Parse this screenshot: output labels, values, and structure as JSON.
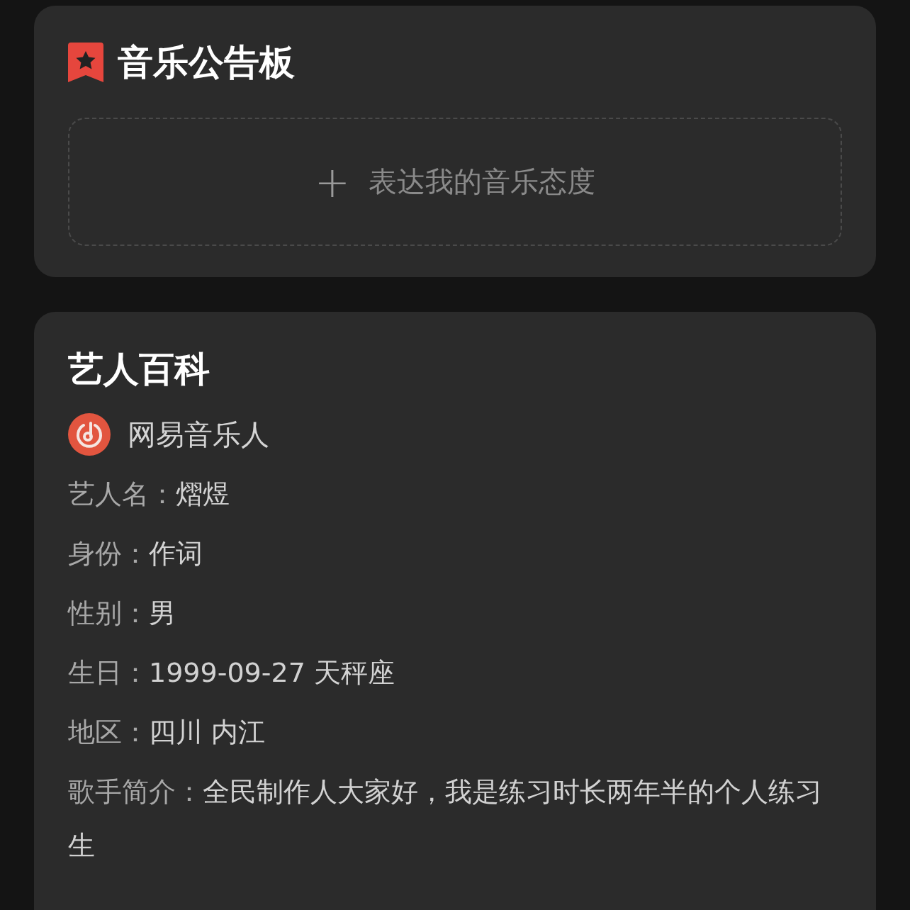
{
  "bulletin": {
    "title": "音乐公告板",
    "add_button": {
      "icon": "+",
      "label": "表达我的音乐态度"
    }
  },
  "artist_wiki": {
    "title": "艺人百科",
    "badge": "网易音乐人",
    "fields": [
      {
        "label": "艺人名：",
        "value": "熠煜"
      },
      {
        "label": "身份：",
        "value": "作词"
      },
      {
        "label": "性别：",
        "value": "男"
      },
      {
        "label": "生日：",
        "value": "1999-09-27 天秤座"
      },
      {
        "label": "地区：",
        "value": "四川 内江"
      },
      {
        "label": "歌手简介：",
        "value": "全民制作人大家好，我是练习时长两年半的个人练习生"
      }
    ]
  }
}
